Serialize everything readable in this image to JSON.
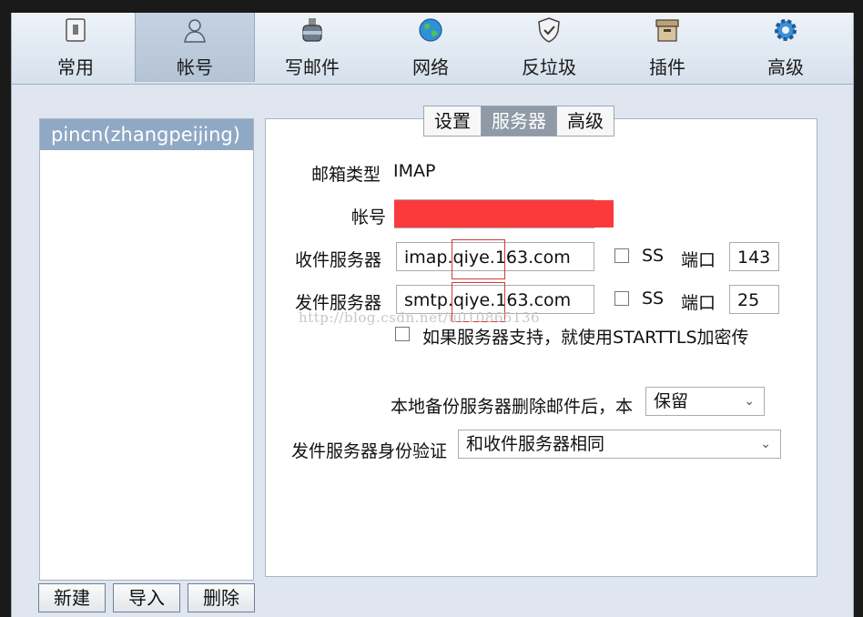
{
  "toolbar": {
    "items": [
      {
        "label": "常用",
        "icon": "switch-icon"
      },
      {
        "label": "帐号",
        "icon": "user-icon"
      },
      {
        "label": "写邮件",
        "icon": "inkwell-icon"
      },
      {
        "label": "网络",
        "icon": "globe-icon"
      },
      {
        "label": "反垃圾",
        "icon": "shield-icon"
      },
      {
        "label": "插件",
        "icon": "box-icon"
      },
      {
        "label": "高级",
        "icon": "gear-icon"
      }
    ],
    "active": "帐号"
  },
  "accounts": {
    "items": [
      "pincn(zhangpeijing)"
    ],
    "selected": "pincn(zhangpeijing)"
  },
  "account_buttons": {
    "new": "新建",
    "import": "导入",
    "delete": "删除"
  },
  "subtabs": {
    "settings": "设置",
    "server": "服务器",
    "advanced": "高级",
    "active": "服务器"
  },
  "server": {
    "mailbox_type_label": "邮箱类型",
    "mailbox_type_value": "IMAP",
    "account_label": "帐号",
    "incoming_label": "收件服务器",
    "incoming_value": "imap.qiye.163.com",
    "outgoing_label": "发件服务器",
    "outgoing_value": "smtp.qiye.163.com",
    "ss_label": "SS",
    "port_label": "端口",
    "incoming_port": "143",
    "outgoing_port": "25",
    "starttls_label": "如果服务器支持，就使用STARTTLS加密传",
    "local_backup_label": "本地备份",
    "after_delete_label": "服务器删除邮件后，本",
    "after_delete_value": "保留",
    "auth_label": "发件服务器身份验证",
    "auth_value": "和收件服务器相同"
  },
  "watermark": "http://blog.csdn.net/u010865136"
}
